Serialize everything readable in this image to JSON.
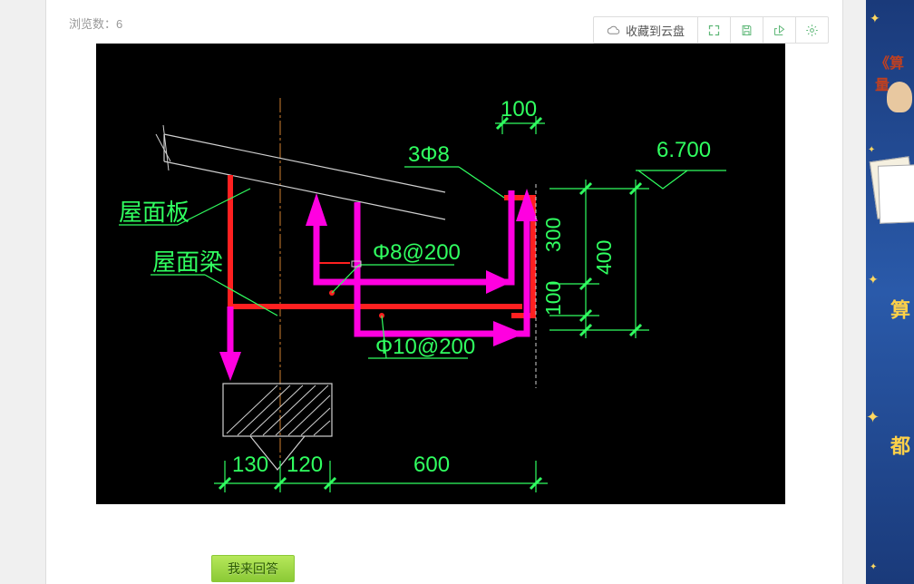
{
  "view_label": "浏览数：",
  "view_count": "6",
  "toolbar": {
    "cloud": "收藏到云盘"
  },
  "answer_button": "我来回答",
  "cad": {
    "roof_slab": "屋面板",
    "roof_beam": "屋面梁",
    "rebar1": "3Φ8",
    "rebar2": "Φ8@200",
    "rebar3": "Φ10@200",
    "dim_130": "130",
    "dim_120": "120",
    "dim_600": "600",
    "dim_100_top": "100",
    "dim_300": "300",
    "dim_100_mid": "100",
    "dim_400": "400",
    "elev": "6.700"
  },
  "ad": {
    "book_title": "《算量"
  }
}
